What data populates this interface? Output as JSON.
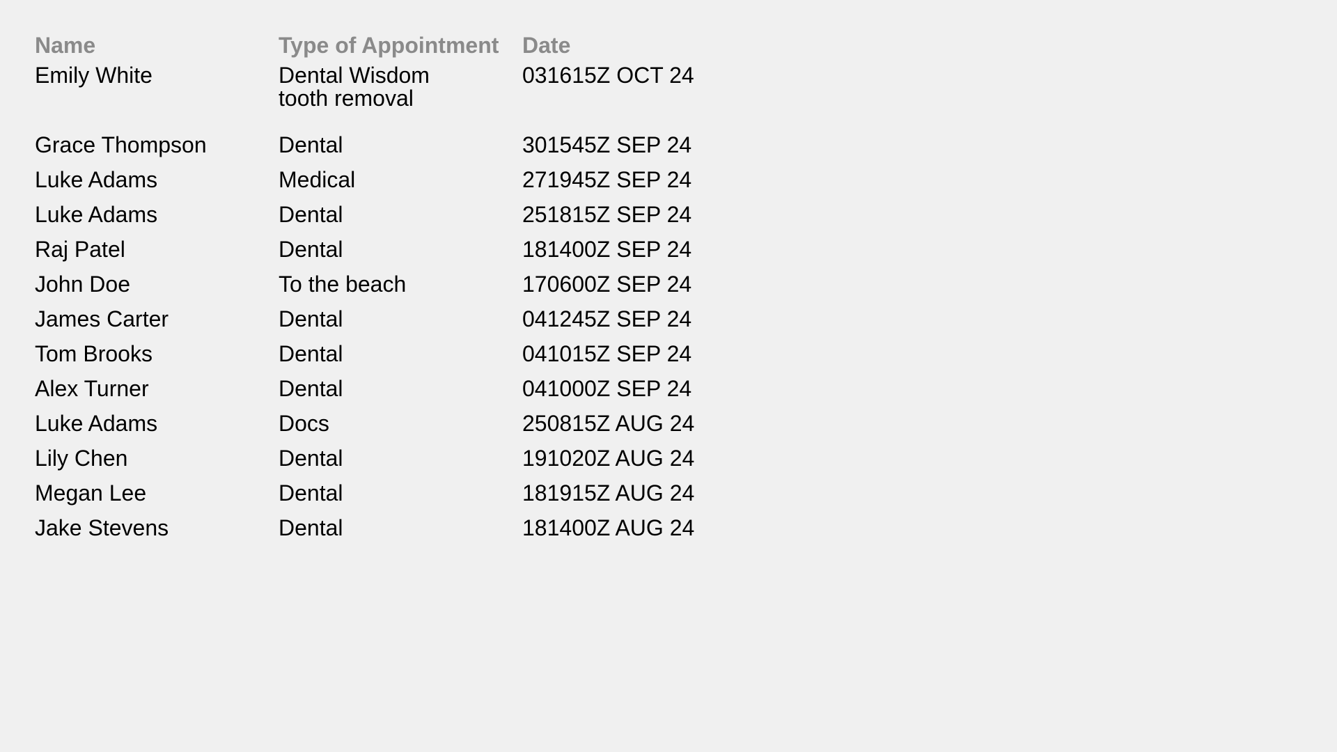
{
  "columns": {
    "name": "Name",
    "type": "Type of Appointment",
    "date": "Date"
  },
  "rows": [
    {
      "name": "Emily White",
      "type": "Dental Wisdom tooth removal",
      "date": "031615Z OCT 24"
    },
    {
      "name": "Grace Thompson",
      "type": "Dental",
      "date": "301545Z SEP 24"
    },
    {
      "name": "Luke Adams",
      "type": "Medical",
      "date": "271945Z SEP 24"
    },
    {
      "name": "Luke Adams",
      "type": "Dental",
      "date": "251815Z SEP 24"
    },
    {
      "name": "Raj Patel",
      "type": "Dental",
      "date": "181400Z SEP 24"
    },
    {
      "name": "John Doe",
      "type": "To the beach",
      "date": "170600Z SEP 24"
    },
    {
      "name": "James Carter",
      "type": "Dental",
      "date": "041245Z SEP 24"
    },
    {
      "name": "Tom Brooks",
      "type": "Dental",
      "date": "041015Z SEP 24"
    },
    {
      "name": "Alex Turner",
      "type": "Dental",
      "date": "041000Z SEP 24"
    },
    {
      "name": "Luke Adams",
      "type": "Docs",
      "date": "250815Z AUG 24"
    },
    {
      "name": "Lily Chen",
      "type": "Dental",
      "date": "191020Z AUG 24"
    },
    {
      "name": "Megan Lee",
      "type": "Dental",
      "date": "181915Z AUG 24"
    },
    {
      "name": "Jake Stevens",
      "type": "Dental",
      "date": "181400Z AUG 24"
    }
  ]
}
